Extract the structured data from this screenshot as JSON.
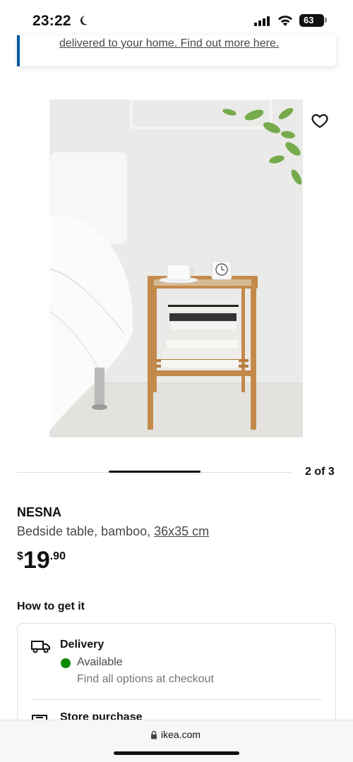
{
  "status_bar": {
    "time": "23:22",
    "battery": "63"
  },
  "banner": {
    "link_text": "delivered to your home. Find out more here."
  },
  "gallery": {
    "counter": "2 of 3",
    "position": 2,
    "total": 3
  },
  "product": {
    "name": "NESNA",
    "description": "Bedside table, bamboo, ",
    "dimensions": "36x35 cm",
    "price_currency": "$",
    "price_integer": "19",
    "price_decimal": ".90"
  },
  "fulfillment": {
    "heading": "How to get it",
    "delivery": {
      "title": "Delivery",
      "status": "Available",
      "status_color": "#0a8a00",
      "hint": "Find all options at checkout",
      "icon": "truck-icon"
    },
    "store": {
      "title": "Store purchase",
      "icon": "store-icon"
    }
  },
  "browser": {
    "url": "ikea.com"
  },
  "colors": {
    "accent": "#0058a3",
    "text": "#111111",
    "muted": "#484848"
  }
}
